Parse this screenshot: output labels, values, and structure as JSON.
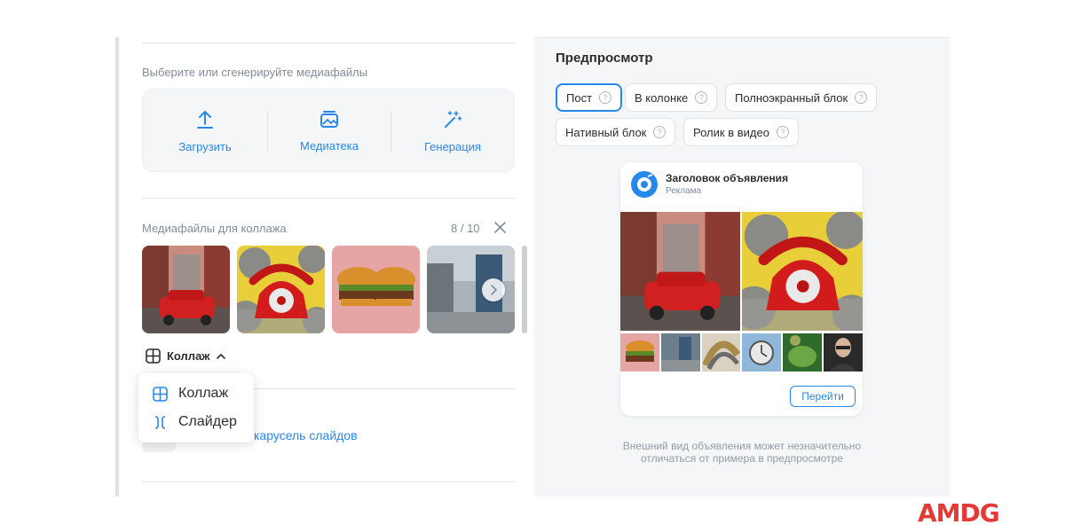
{
  "left": {
    "media_prompt": "Выберите или сгенерируйте медиафайлы",
    "upload_actions": [
      {
        "label": "Загрузить",
        "icon": "upload-icon"
      },
      {
        "label": "Медиатека",
        "icon": "gallery-icon"
      },
      {
        "label": "Генерация",
        "icon": "magic-wand-icon"
      }
    ],
    "collage_title": "Медиафайлы для коллажа",
    "collage_count": "8 / 10",
    "mode_label": "Коллаж",
    "dropdown": [
      {
        "label": "Коллаж",
        "icon": "grid-icon"
      },
      {
        "label": "Слайдер",
        "icon": "slider-icon"
      }
    ],
    "carousel_label": "карусель слайдов"
  },
  "right": {
    "title": "Предпросмотр",
    "formats": [
      "Пост",
      "В колонке",
      "Полноэкранный блок",
      "Нативный блок",
      "Ролик в видео"
    ],
    "selected_format": "Пост",
    "card": {
      "headline": "Заголовок объявления",
      "subtitle": "Реклама",
      "button": "Перейти"
    },
    "note_line1": "Внешний вид объявления может незначительно",
    "note_line2": "отличаться от примера в предпросмотре"
  },
  "brand": {
    "logo_text": "AMDG",
    "logo_color": "#e53935",
    "accent": "#2688eb"
  }
}
